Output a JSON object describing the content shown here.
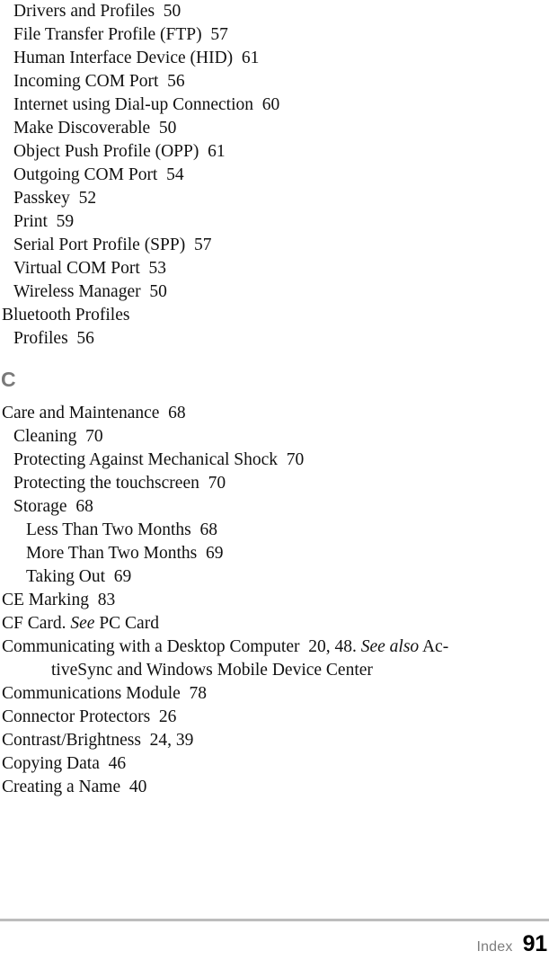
{
  "page": {
    "section_letter": "C",
    "footer": {
      "label": "Index",
      "page_number": "91"
    }
  },
  "entries_before_letter": [
    {
      "level": 1,
      "text": "Drivers and Profiles  50"
    },
    {
      "level": 1,
      "text": "File Transfer Profile (FTP)  57"
    },
    {
      "level": 1,
      "text": "Human Interface Device (HID)  61"
    },
    {
      "level": 1,
      "text": "Incoming COM Port  56"
    },
    {
      "level": 1,
      "text": "Internet using Dial-up Connection  60"
    },
    {
      "level": 1,
      "text": "Make Discoverable  50"
    },
    {
      "level": 1,
      "text": "Object Push Profile (OPP)  61"
    },
    {
      "level": 1,
      "text": "Outgoing COM Port  54"
    },
    {
      "level": 1,
      "text": "Passkey  52"
    },
    {
      "level": 1,
      "text": "Print  59"
    },
    {
      "level": 1,
      "text": "Serial Port Profile (SPP)  57"
    },
    {
      "level": 1,
      "text": "Virtual COM Port  53"
    },
    {
      "level": 1,
      "text": "Wireless Manager  50"
    },
    {
      "level": 0,
      "text": "Bluetooth Profiles"
    },
    {
      "level": 1,
      "text": "Profiles  56"
    }
  ],
  "entries_after_letter": [
    {
      "level": 0,
      "text": "Care and Maintenance  68"
    },
    {
      "level": 1,
      "text": "Cleaning  70"
    },
    {
      "level": 1,
      "text": "Protecting Against Mechanical Shock  70"
    },
    {
      "level": 1,
      "text": "Protecting the touchscreen  70"
    },
    {
      "level": 1,
      "text": "Storage  68"
    },
    {
      "level": 2,
      "text": "Less Than Two Months  68"
    },
    {
      "level": 2,
      "text": "More Than Two Months  69"
    },
    {
      "level": 2,
      "text": "Taking Out  69"
    },
    {
      "level": 0,
      "text": "CE Marking  83"
    },
    {
      "level": 0,
      "runs": [
        {
          "text": "CF Card. ",
          "style": "roman"
        },
        {
          "text": "See",
          "style": "italic"
        },
        {
          "text": " PC Card",
          "style": "roman"
        }
      ]
    },
    {
      "level": 0,
      "wrap": true,
      "runs": [
        {
          "text": "Communicating with a Desktop Computer  20, 48. ",
          "style": "roman"
        },
        {
          "text": "See also",
          "style": "italic"
        },
        {
          "text": " Ac-",
          "style": "roman"
        },
        {
          "text": "tiveSync and Windows Mobile Device Center",
          "style": "roman",
          "newline": true
        }
      ]
    },
    {
      "level": 0,
      "text": "Communications Module  78"
    },
    {
      "level": 0,
      "text": "Connector Protectors  26"
    },
    {
      "level": 0,
      "text": "Contrast/Brightness  24, 39"
    },
    {
      "level": 0,
      "text": "Copying Data  46"
    },
    {
      "level": 0,
      "text": "Creating a Name  40"
    }
  ]
}
